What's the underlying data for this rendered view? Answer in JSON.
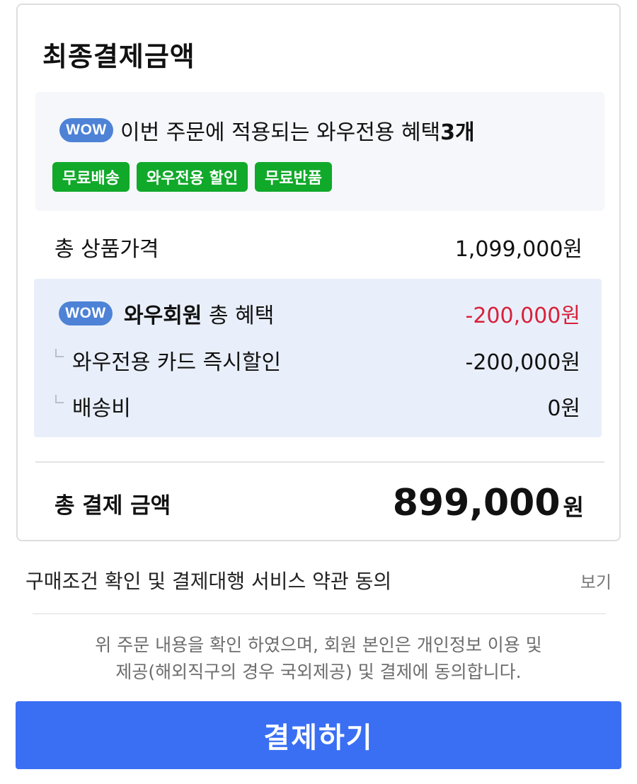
{
  "card": {
    "title": "최종결제금액",
    "wow_banner": {
      "badge": "WOW",
      "text_prefix": "이번 주문에 적용되는 와우전용 혜택",
      "count": "3개",
      "chips": [
        "무료배송",
        "와우전용 할인",
        "무료반품"
      ]
    },
    "product_price": {
      "label": "총 상품가격",
      "value": "1,099,000원"
    },
    "benefits": {
      "badge": "WOW",
      "title_bold": "와우회원",
      "title_rest": "총 혜택",
      "total": "-200,000원",
      "items": [
        {
          "label": "와우전용 카드 즉시할인",
          "value": "-200,000원"
        },
        {
          "label": "배송비",
          "value": "0원"
        }
      ]
    },
    "total": {
      "label": "총 결제 금액",
      "amount": "899,000",
      "unit": "원"
    }
  },
  "terms": {
    "label": "구매조건 확인 및 결제대행 서비스 약관 동의",
    "view": "보기"
  },
  "consent": {
    "line1": "위 주문 내용을 확인 하였으며, 회원 본인은 개인정보 이용 및",
    "line2": "제공(해외직구의 경우 국외제공) 및 결제에 동의합니다."
  },
  "pay_button": "결제하기",
  "colors": {
    "wow_badge": "#4d82d6",
    "chip_green": "#11a92a",
    "benefit_red": "#d8213b",
    "pay_blue": "#3a6ff4",
    "benefit_bg": "#e9effa"
  }
}
